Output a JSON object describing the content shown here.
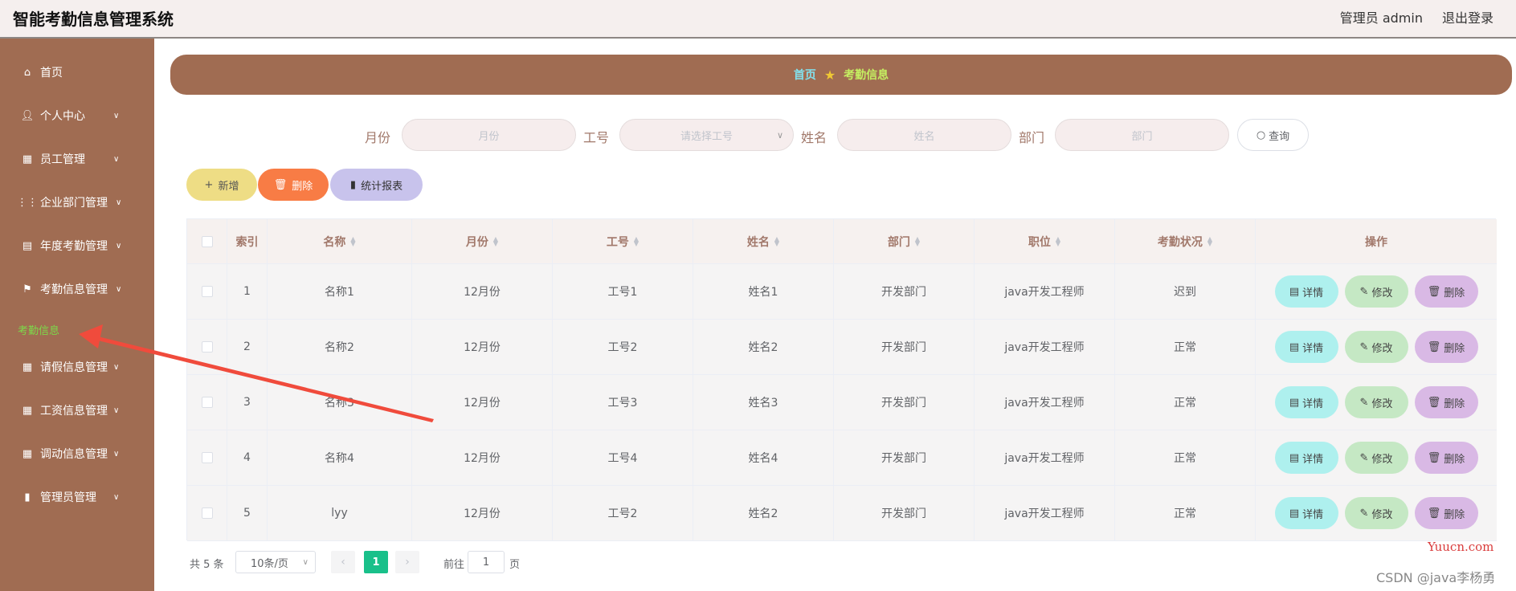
{
  "app_title": "智能考勤信息管理系统",
  "header": {
    "user": "管理员 admin",
    "logout": "退出登录"
  },
  "sidebar": {
    "items": [
      {
        "label": "首页",
        "icon": "home-icon"
      },
      {
        "label": "个人中心",
        "icon": "user-icon"
      },
      {
        "label": "员工管理",
        "icon": "grid-icon"
      },
      {
        "label": "企业部门管理",
        "icon": "apps-icon"
      },
      {
        "label": "年度考勤管理",
        "icon": "clipboard-icon"
      },
      {
        "label": "考勤信息管理",
        "icon": "flag-icon"
      },
      {
        "label": "请假信息管理",
        "icon": "grid-icon"
      },
      {
        "label": "工资信息管理",
        "icon": "grid-icon"
      },
      {
        "label": "调动信息管理",
        "icon": "grid-icon"
      },
      {
        "label": "管理员管理",
        "icon": "bar-chart-icon"
      }
    ],
    "active_sub": "考勤信息"
  },
  "breadcrumb": {
    "home": "首页",
    "current": "考勤信息"
  },
  "search": {
    "month_label": "月份",
    "month_placeholder": "月份",
    "empno_label": "工号",
    "empno_placeholder": "请选择工号",
    "name_label": "姓名",
    "name_placeholder": "姓名",
    "dept_label": "部门",
    "dept_placeholder": "部门",
    "query": "查询"
  },
  "actions": {
    "add": "新增",
    "delete": "删除",
    "stats": "统计报表"
  },
  "table": {
    "headers": [
      "索引",
      "名称",
      "月份",
      "工号",
      "姓名",
      "部门",
      "职位",
      "考勤状况",
      "操作"
    ],
    "rows": [
      {
        "idx": "1",
        "mc": "名称1",
        "month": "12月份",
        "no": "工号1",
        "name": "姓名1",
        "dept": "开发部门",
        "pos": "java开发工程师",
        "status": "迟到"
      },
      {
        "idx": "2",
        "mc": "名称2",
        "month": "12月份",
        "no": "工号2",
        "name": "姓名2",
        "dept": "开发部门",
        "pos": "java开发工程师",
        "status": "正常"
      },
      {
        "idx": "3",
        "mc": "名称3",
        "month": "12月份",
        "no": "工号3",
        "name": "姓名3",
        "dept": "开发部门",
        "pos": "java开发工程师",
        "status": "正常"
      },
      {
        "idx": "4",
        "mc": "名称4",
        "month": "12月份",
        "no": "工号4",
        "name": "姓名4",
        "dept": "开发部门",
        "pos": "java开发工程师",
        "status": "正常"
      },
      {
        "idx": "5",
        "mc": "lyy",
        "month": "12月份",
        "no": "工号2",
        "name": "姓名2",
        "dept": "开发部门",
        "pos": "java开发工程师",
        "status": "正常"
      }
    ],
    "op_detail": "详情",
    "op_edit": "修改",
    "op_delete": "删除"
  },
  "pagination": {
    "total": "共 5 条",
    "page_size": "10条/页",
    "current": "1",
    "goto": "前往",
    "goto_value": "1",
    "unit": "页"
  },
  "watermarks": {
    "site": "Yuucn.com",
    "csdn": "CSDN @java李杨勇"
  },
  "colors": {
    "sidebar": "#a06c52",
    "active_sub": "#7cd94a",
    "page_current": "#19c08a",
    "delete": "#f87c45"
  }
}
